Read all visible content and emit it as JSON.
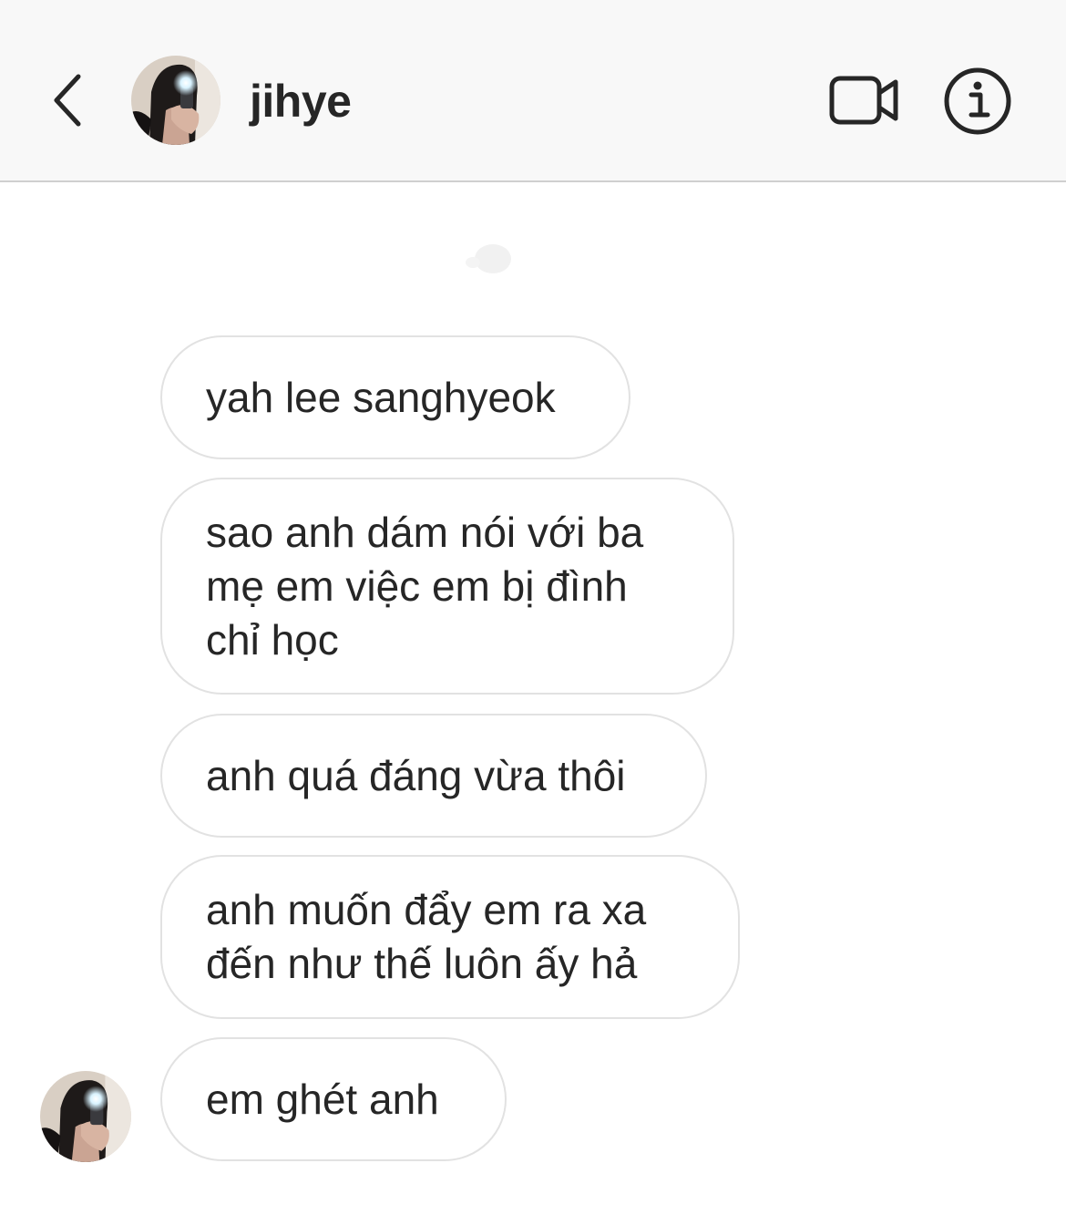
{
  "header": {
    "username": "jihye",
    "back_icon": "chevron-left-icon",
    "video_icon": "video-camera-icon",
    "info_icon": "info-icon"
  },
  "messages": [
    {
      "text": "yah lee sanghyeok"
    },
    {
      "text": "sao anh dám nói với ba\nmẹ em việc em bị đình\nchỉ học"
    },
    {
      "text": "anh quá đáng vừa thôi"
    },
    {
      "text": "anh muốn đẩy em ra xa\nđến như thế luôn ấy hả"
    },
    {
      "text": "em ghét anh"
    }
  ],
  "colors": {
    "header_bg": "#f8f8f8",
    "bubble_border": "#e2e2e2",
    "text": "#262626"
  }
}
